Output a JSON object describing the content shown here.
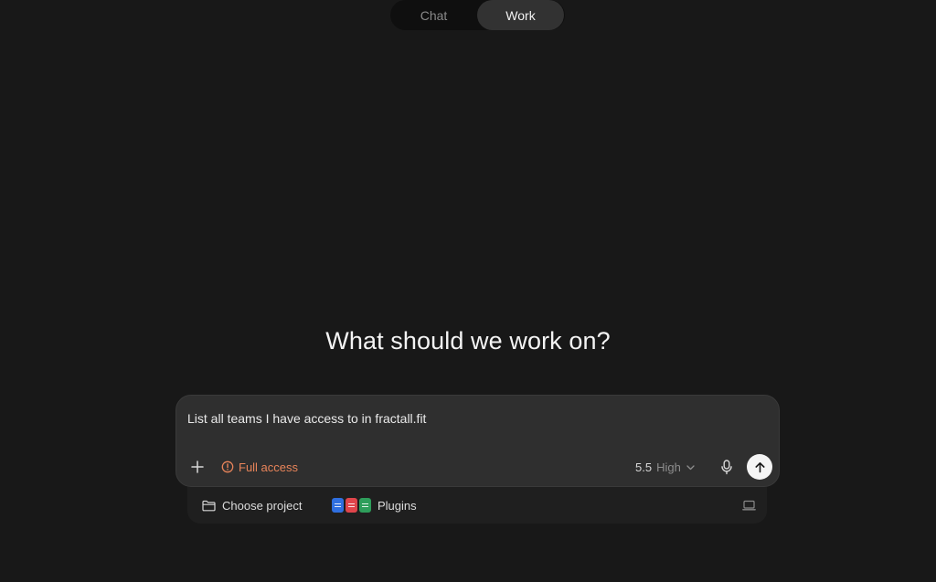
{
  "mode_toggle": {
    "tabs": [
      {
        "label": "Chat",
        "active": false
      },
      {
        "label": "Work",
        "active": true
      }
    ]
  },
  "main": {
    "heading": "What should we work on?"
  },
  "composer": {
    "prompt": "List all teams I have access to in fractall.fit",
    "access_label": "Full access",
    "model_version": "5.5",
    "model_effort": "High"
  },
  "sub_bar": {
    "project_label": "Choose project",
    "plugins_label": "Plugins",
    "plugin_icons": [
      "doc-icon",
      "pdf-icon",
      "sheet-icon"
    ]
  },
  "colors": {
    "background": "#181818",
    "composer": "#2f2f2f",
    "access": "#e8845a",
    "doc": "#2f6fe0",
    "pdf": "#e0454b",
    "sheet": "#2e9e5b"
  }
}
